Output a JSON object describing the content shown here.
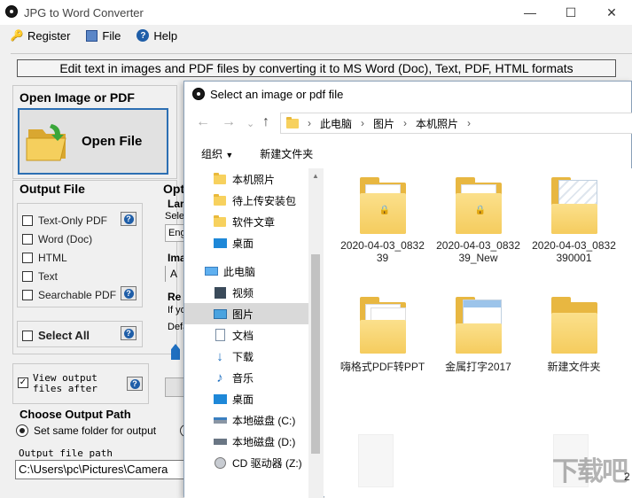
{
  "app": {
    "title": "JPG to Word Converter",
    "window_controls": {
      "minimize": "—",
      "maximize": "☐",
      "close": "✕"
    }
  },
  "menu": {
    "register": "Register",
    "file": "File",
    "help": "Help"
  },
  "banner": "Edit text in images and PDF files by converting it to MS Word (Doc), Text, PDF, HTML formats",
  "open": {
    "section": "Open Image or PDF",
    "button": "Open File"
  },
  "output": {
    "section": "Output File",
    "options": [
      {
        "label": "Text-Only PDF",
        "help": true
      },
      {
        "label": "Word (Doc)",
        "help": false
      },
      {
        "label": "HTML",
        "help": false
      },
      {
        "label": "Text",
        "help": false
      },
      {
        "label": "Searchable PDF",
        "help": true
      }
    ],
    "select_all": "Select All"
  },
  "options_partial": {
    "section": "Opt",
    "lang_prefix": "Lar",
    "lang_sub": "Sele",
    "lang_value": "Eng",
    "image_prefix": "Ima",
    "image_char": "A",
    "re_prefix": "Re",
    "re_line1": "If yo",
    "re_line2": "Defa"
  },
  "view_output": {
    "line1": "View output",
    "line2": "files after"
  },
  "output_path": {
    "section": "Choose Output Path",
    "option": "Set same folder for output",
    "label": "Output file path",
    "value": "C:\\Users\\pc\\Pictures\\Camera"
  },
  "dialog": {
    "title": "Select an image or pdf file",
    "breadcrumb": [
      "此电脑",
      "图片",
      "本机照片"
    ],
    "toolbar": {
      "organize": "组织",
      "new_folder": "新建文件夹"
    },
    "tree": [
      "本机照片",
      "待上传安装包",
      "软件文章",
      "桌面",
      "此电脑",
      "视频",
      "图片",
      "文档",
      "下载",
      "音乐",
      "桌面",
      "本地磁盘 (C:)",
      "本地磁盘 (D:)",
      "CD 驱动器 (Z:)"
    ],
    "files": [
      {
        "name": "2020-04-03_083239"
      },
      {
        "name": "2020-04-03_083239_New"
      },
      {
        "name": "2020-04-03_0832390001"
      },
      {
        "name": "嗨格式PDF转PPT"
      },
      {
        "name": "金属打字2017"
      },
      {
        "name": "新建文件夹"
      }
    ],
    "partial_text": "2"
  },
  "watermark": "下载吧"
}
